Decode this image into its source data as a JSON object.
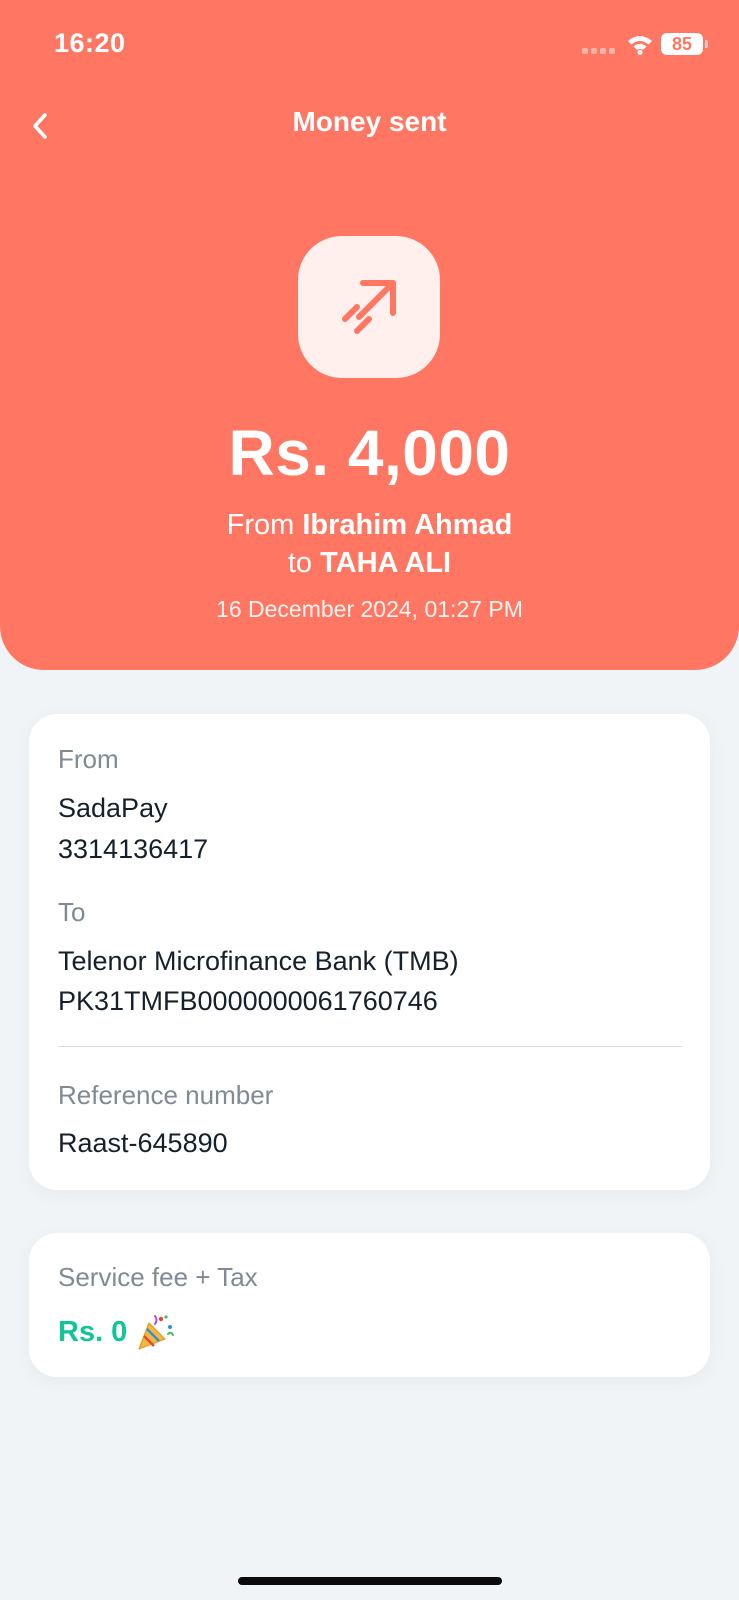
{
  "status_bar": {
    "time": "16:20",
    "battery": "85"
  },
  "header": {
    "title": "Money sent",
    "amount": "Rs. 4,000",
    "from_prefix": "From",
    "from_name": "Ibrahim Ahmad",
    "to_prefix": "to",
    "to_name": "TAHA ALI",
    "datetime": "16 December 2024, 01:27 PM",
    "icon": "arrow-up-right-icon"
  },
  "details": {
    "from_label": "From",
    "from_provider": "SadaPay",
    "from_account": "3314136417",
    "to_label": "To",
    "to_bank": "Telenor Microfinance Bank (TMB)",
    "to_account": "PK31TMFB0000000061760746",
    "reference_label": "Reference number",
    "reference_value": "Raast-645890"
  },
  "fee": {
    "label": "Service fee + Tax",
    "value": "Rs. 0",
    "icon": "party-popper-icon"
  },
  "colors": {
    "brand": "#ff7762",
    "fee_green": "#12c49a",
    "background": "#f1f4f6"
  }
}
